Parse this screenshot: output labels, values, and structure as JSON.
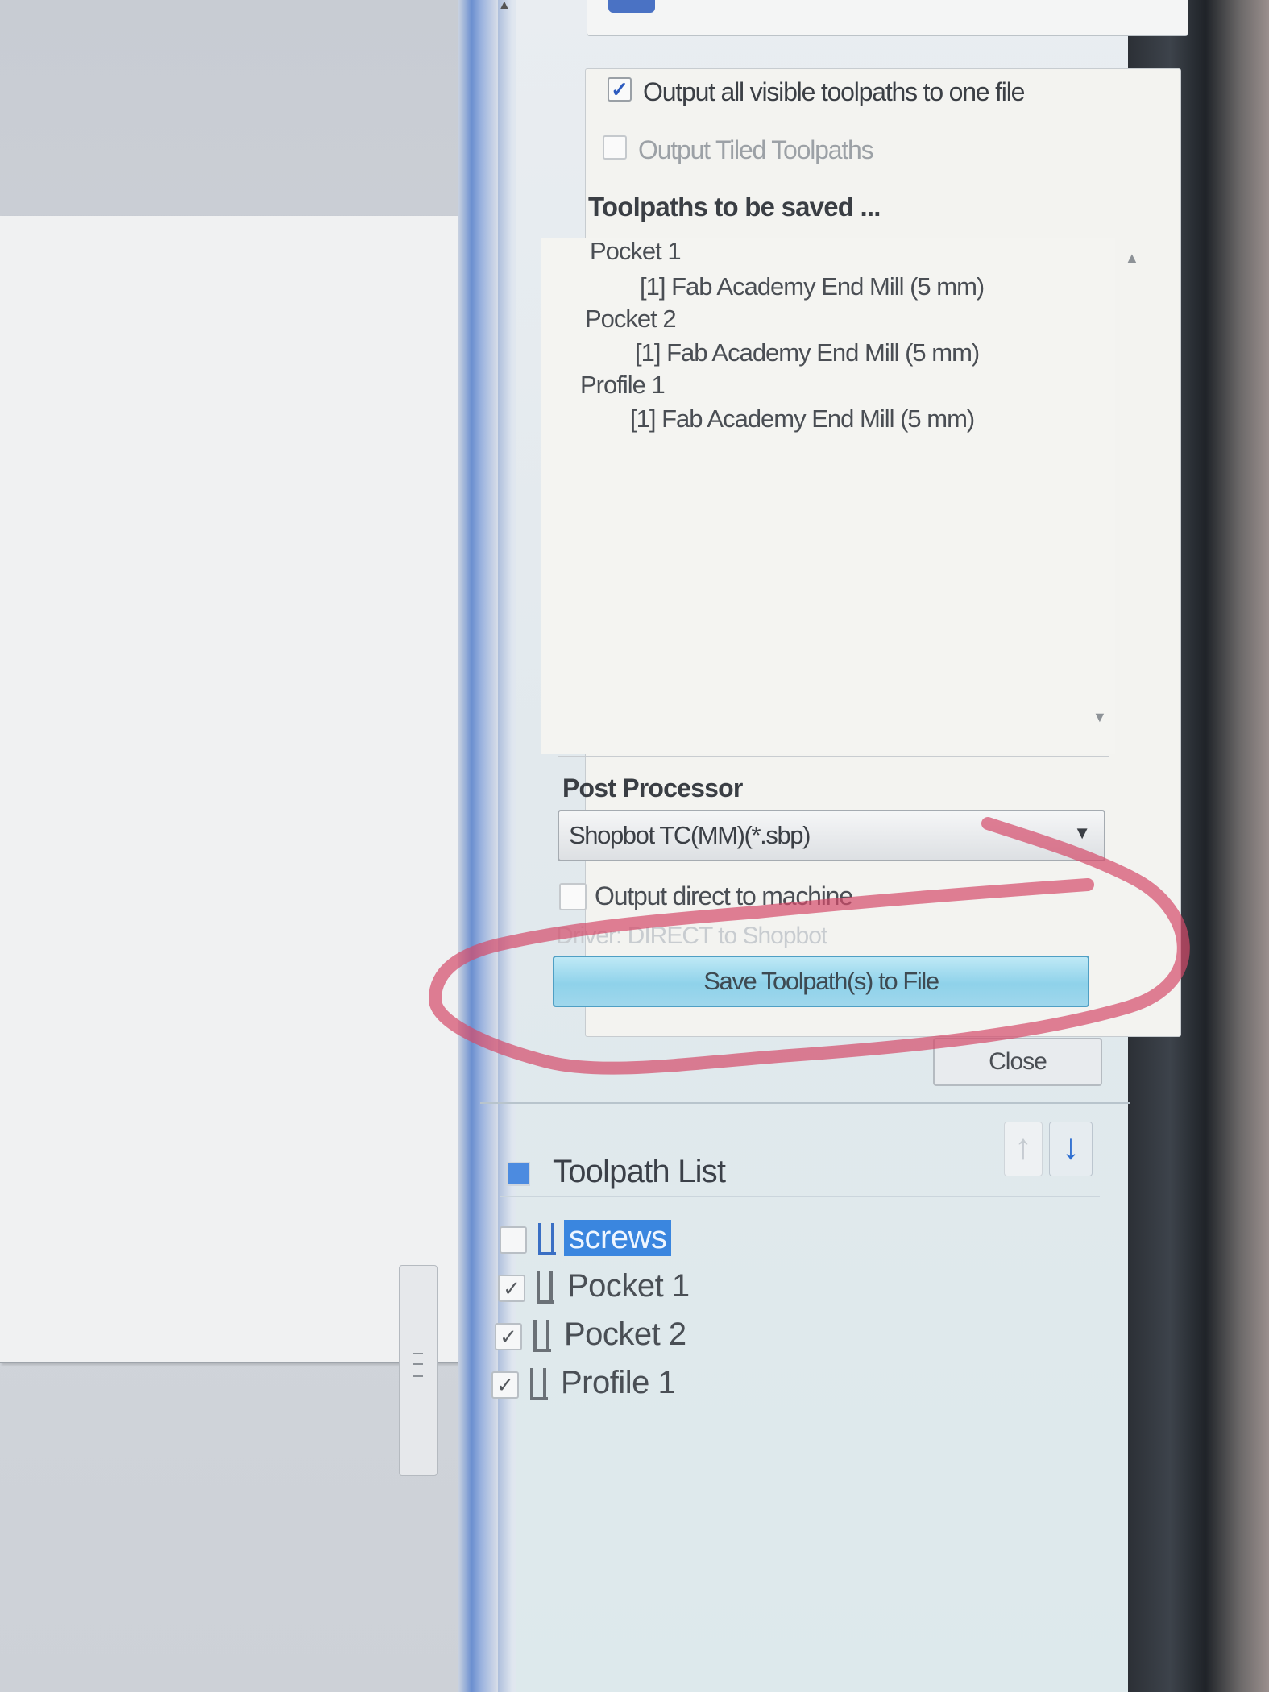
{
  "save_panel": {
    "output_all_label": "Output all visible toolpaths to one file",
    "output_all_checked": true,
    "output_tiled_label": "Output Tiled Toolpaths",
    "output_tiled_checked": false,
    "toolpaths_header": "Toolpaths to be saved ...",
    "toolpaths": [
      {
        "name": "Pocket 1",
        "tool": "[1] Fab Academy End Mill (5 mm)"
      },
      {
        "name": "Pocket 2",
        "tool": "[1] Fab Academy End Mill (5 mm)"
      },
      {
        "name": "Profile 1",
        "tool": "[1] Fab Academy End Mill (5 mm)"
      }
    ],
    "post_processor_header": "Post Processor",
    "post_processor_value": "Shopbot TC(MM)(*.sbp)",
    "output_direct_label": "Output direct to machine",
    "output_direct_checked": false,
    "driver_text": "Driver: DIRECT to Shopbot",
    "save_button_label": "Save Toolpath(s) to File",
    "close_button_label": "Close"
  },
  "toolpath_list": {
    "title": "Toolpath List",
    "items": [
      {
        "name": "screws",
        "checked": false,
        "selected": true
      },
      {
        "name": "Pocket 1",
        "checked": true,
        "selected": false
      },
      {
        "name": "Pocket 2",
        "checked": true,
        "selected": false
      },
      {
        "name": "Profile 1",
        "checked": true,
        "selected": false
      }
    ]
  },
  "icons": {
    "move_up": "arrow-up-icon",
    "move_down": "arrow-down-icon",
    "tool": "end-mill-tool-icon"
  },
  "colors": {
    "accent_blue": "#3a86df",
    "save_button": "#9fd7ec",
    "annotation_red": "#d44a6a"
  }
}
